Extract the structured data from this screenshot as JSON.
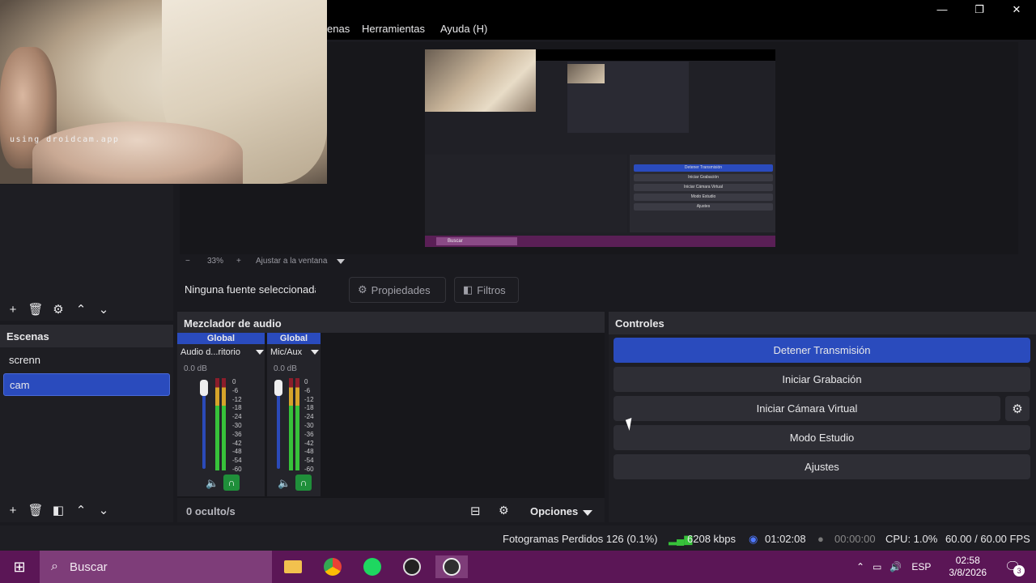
{
  "window": {
    "minimize": "—",
    "maximize": "❐",
    "close": "✕"
  },
  "menu": {
    "items": [
      "enas",
      "Herramientas",
      "Ayuda (H)"
    ]
  },
  "camera": {
    "watermark": "using droidcam.app"
  },
  "preview_mini": {
    "btn1": "Detener Transmisión",
    "btn2": "Iniciar Grabación",
    "btn3": "Iniciar Cámara Virtual",
    "btn4": "Modo Estudio",
    "btn5": "Ajustes",
    "search": "Buscar"
  },
  "zoom": {
    "minus": "−",
    "level": "33%",
    "plus": "+",
    "fit": "Ajustar a la ventana"
  },
  "properties": {
    "no_source": "Ninguna fuente seleccionada",
    "properties_label": "Propiedades",
    "filters_label": "Filtros"
  },
  "scenes": {
    "header": "Escenas",
    "items": [
      "screnn",
      "cam"
    ],
    "active_index": 1
  },
  "mixer": {
    "header": "Mezclador de audio",
    "channels": [
      {
        "scope": "Global",
        "name": "Audio d...ritorio",
        "db": "0.0 dB"
      },
      {
        "scope": "Global",
        "name": "Mic/Aux",
        "db": "0.0 dB"
      }
    ],
    "ticks": [
      "0",
      "-6",
      "-12",
      "-18",
      "-24",
      "-30",
      "-36",
      "-42",
      "-48",
      "-54",
      "-60"
    ],
    "hidden_label": "0 oculto/s",
    "options_label": "Opciones"
  },
  "controls": {
    "header": "Controles",
    "buttons": [
      "Detener Transmisión",
      "Iniciar Grabación",
      "Iniciar Cámara Virtual",
      "Modo Estudio",
      "Ajustes"
    ]
  },
  "status": {
    "dropped": "Fotogramas Perdidos 126 (0.1%)",
    "bitrate": "6208 kbps",
    "stream_time": "01:02:08",
    "rec_time": "00:00:00",
    "cpu": "CPU: 1.0%",
    "fps": "60.00 / 60.00 FPS"
  },
  "taskbar": {
    "search": "Buscar",
    "lang": "ESP",
    "time": "02:58",
    "date": "3/8/2026",
    "notifications": "3"
  },
  "colors": {
    "accent": "#2a4bbd",
    "taskbar": "#5b1656",
    "search": "#7e3d79",
    "meter_green": "#37c23a"
  }
}
